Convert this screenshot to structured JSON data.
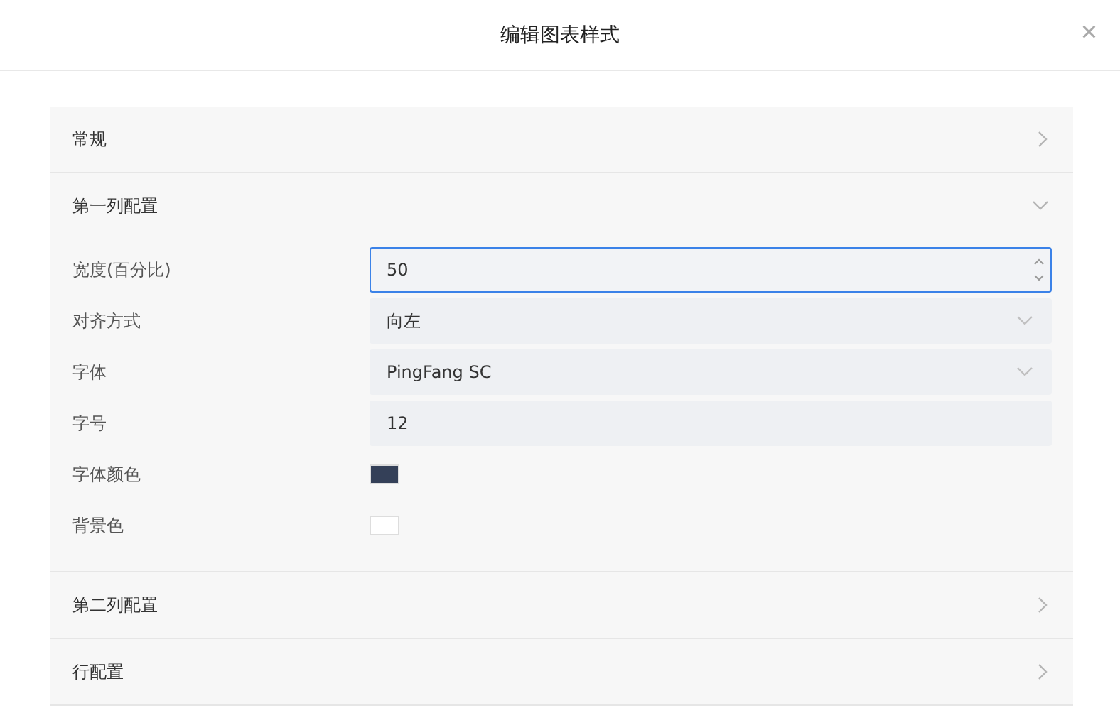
{
  "dialog": {
    "title": "编辑图表样式",
    "close": "×"
  },
  "sections": [
    {
      "title": "常规",
      "expanded": false
    },
    {
      "title": "第一列配置",
      "expanded": true,
      "fields": [
        {
          "label": "宽度(百分比)",
          "kind": "number",
          "value": "50",
          "focused": true
        },
        {
          "label": "对齐方式",
          "kind": "select",
          "value": "向左",
          "focused": false
        },
        {
          "label": "字体",
          "kind": "select",
          "value": "PingFang SC",
          "focused": false
        },
        {
          "label": "字号",
          "kind": "text",
          "value": "12",
          "focused": false
        },
        {
          "label": "字体颜色",
          "kind": "color",
          "color": "#344058"
        },
        {
          "label": "背景色",
          "kind": "color",
          "color": "#ffffff"
        }
      ]
    },
    {
      "title": "第二列配置",
      "expanded": false
    },
    {
      "title": "行配置",
      "expanded": false
    }
  ]
}
